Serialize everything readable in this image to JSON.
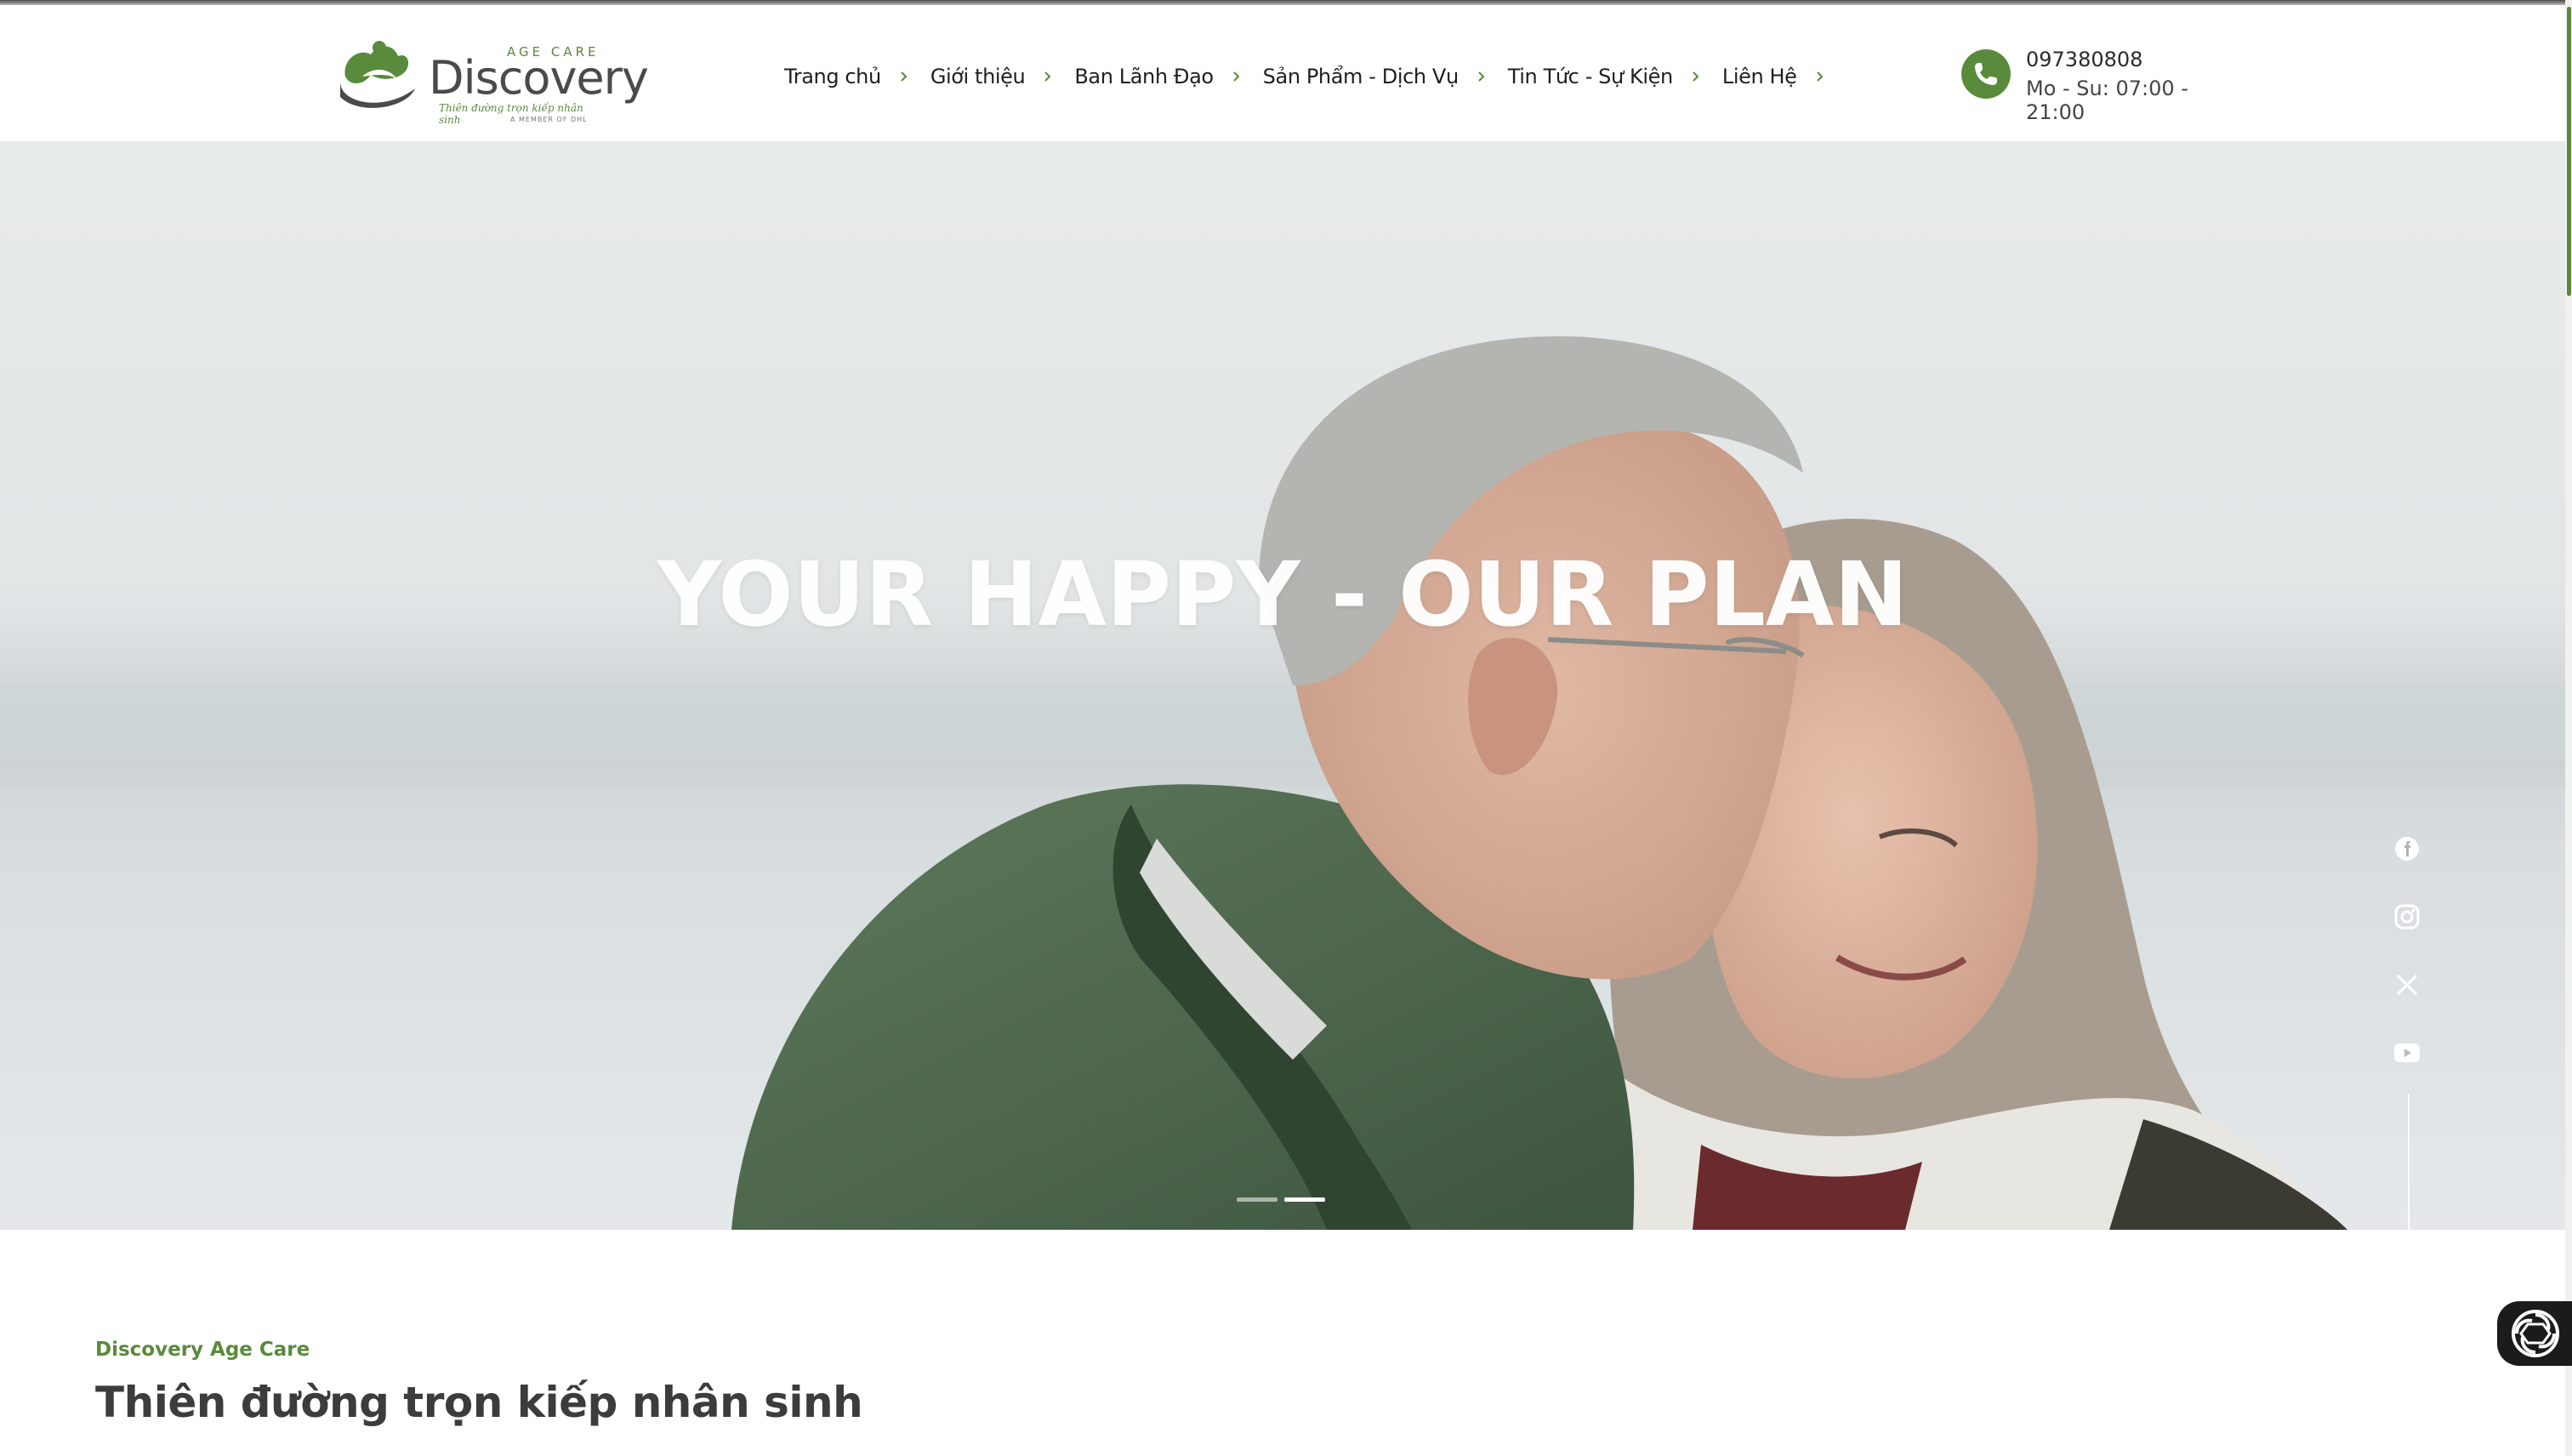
{
  "header": {
    "logo": {
      "brand": "Discovery",
      "subbrand": "AGE CARE",
      "tagline": "Thiên đường trọn kiếp nhân sinh",
      "member_note": "A MEMBER OF DHL"
    },
    "nav": [
      {
        "label": "Trang chủ"
      },
      {
        "label": "Giới thiệu"
      },
      {
        "label": "Ban Lãnh Đạo"
      },
      {
        "label": "Sản Phẩm - Dịch Vụ"
      },
      {
        "label": "Tin Tức - Sự Kiện"
      },
      {
        "label": "Liên Hệ"
      }
    ],
    "contact": {
      "phone": "097380808",
      "hours": "Mo - Su: 07:00 - 21:00",
      "icon": "phone-icon"
    }
  },
  "hero": {
    "title": "YOUR HAPPY - OUR PLAN",
    "slides_total": 2,
    "active_slide": 2,
    "social": [
      "facebook-icon",
      "instagram-icon",
      "x-icon",
      "youtube-icon"
    ]
  },
  "intro": {
    "kicker": "Discovery Age Care",
    "title": "Thiên đường trọn kiếp nhân sinh"
  },
  "colors": {
    "brand_green": "#5a8a3c",
    "text_dark": "#1f1f1f",
    "title_gray": "#3c3c3c"
  }
}
